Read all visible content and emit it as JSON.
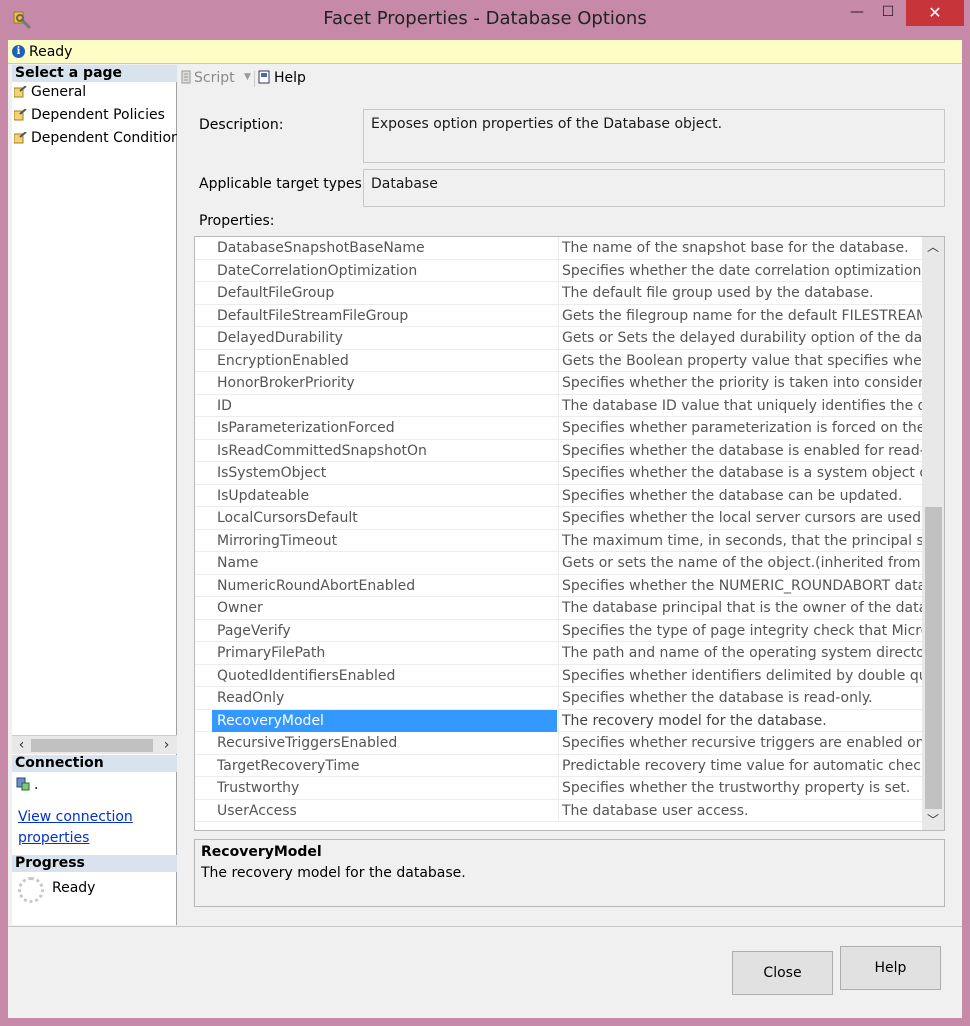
{
  "window": {
    "title": "Facet Properties - Database Options",
    "minimize_glyph": "—",
    "maximize_glyph": "☐",
    "close_glyph": "✕"
  },
  "status": {
    "text": "Ready",
    "icon": "info-icon"
  },
  "left_pane": {
    "select_page_header": "Select a page",
    "pages": [
      {
        "label": "General",
        "icon": "wrench-page-icon"
      },
      {
        "label": "Dependent Policies",
        "icon": "wrench-page-icon"
      },
      {
        "label": "Dependent Conditions",
        "icon": "wrench-page-icon"
      }
    ],
    "connection_header": "Connection",
    "connection_value": ".",
    "connection_link_line1": "View connection",
    "connection_link_line2": "properties",
    "progress_header": "Progress",
    "progress_text": "Ready"
  },
  "toolbar": {
    "script_label": "Script",
    "help_label": "Help"
  },
  "form": {
    "description_label": "Description:",
    "description_value": "Exposes option properties of the Database object.",
    "target_types_label": "Applicable target types:",
    "target_types_value": "Database",
    "properties_label": "Properties:"
  },
  "properties": [
    {
      "name": "DatabaseSnapshotBaseName",
      "desc": "The name of the snapshot base for the database."
    },
    {
      "name": "DateCorrelationOptimization",
      "desc": "Specifies whether the date correlation optimization is a"
    },
    {
      "name": "DefaultFileGroup",
      "desc": "The default file group used by the database."
    },
    {
      "name": "DefaultFileStreamFileGroup",
      "desc": "Gets the filegroup name for the default FILESTREAM fil"
    },
    {
      "name": "DelayedDurability",
      "desc": "Gets or Sets the delayed durability option of the datab"
    },
    {
      "name": "EncryptionEnabled",
      "desc": "Gets the Boolean property value that specifies whether"
    },
    {
      "name": "HonorBrokerPriority",
      "desc": "Specifies whether the priority is taken into consideratio"
    },
    {
      "name": "ID",
      "desc": "The database ID value that uniquely identifies the datal"
    },
    {
      "name": "IsParameterizationForced",
      "desc": "Specifies whether parameterization is forced on the dat"
    },
    {
      "name": "IsReadCommittedSnapshotOn",
      "desc": "Specifies whether the database is enabled for read-con"
    },
    {
      "name": "IsSystemObject",
      "desc": "Specifies whether the database is a system object or a"
    },
    {
      "name": "IsUpdateable",
      "desc": "Specifies whether the database can be updated."
    },
    {
      "name": "LocalCursorsDefault",
      "desc": "Specifies whether the local server cursors are used by c"
    },
    {
      "name": "MirroringTimeout",
      "desc": "The maximum time, in seconds, that the principal serve"
    },
    {
      "name": "Name",
      "desc": "Gets or sets the name of the object.(inherited from Nar"
    },
    {
      "name": "NumericRoundAbortEnabled",
      "desc": "Specifies whether the NUMERIC_ROUNDABORT databa"
    },
    {
      "name": "Owner",
      "desc": "The database principal that is the owner of the databas"
    },
    {
      "name": "PageVerify",
      "desc": "Specifies the type of page integrity check that Microso"
    },
    {
      "name": "PrimaryFilePath",
      "desc": "The path and name of the operating system directory t"
    },
    {
      "name": "QuotedIdentifiersEnabled",
      "desc": "Specifies whether identifiers delimited by double quota"
    },
    {
      "name": "ReadOnly",
      "desc": "Specifies whether the database is read-only."
    },
    {
      "name": "RecoveryModel",
      "desc": "The recovery model for the database.",
      "selected": true
    },
    {
      "name": "RecursiveTriggersEnabled",
      "desc": "Specifies whether recursive triggers are enabled on the"
    },
    {
      "name": "TargetRecoveryTime",
      "desc": "Predictable recovery time value for automatic checkpoi"
    },
    {
      "name": "Trustworthy",
      "desc": "Specifies whether the trustworthy property is set."
    },
    {
      "name": "UserAccess",
      "desc": "The database user access."
    }
  ],
  "selected_property": {
    "name": "RecoveryModel",
    "desc": "The recovery model for the database."
  },
  "buttons": {
    "close": "Close",
    "help": "Help"
  },
  "colors": {
    "window_frame": "#c68aa8",
    "close_button": "#c7353a",
    "selection": "#3399ff",
    "status_bar": "#fdfdc6",
    "section_header": "#d9e3ee",
    "link": "#0033cc"
  }
}
